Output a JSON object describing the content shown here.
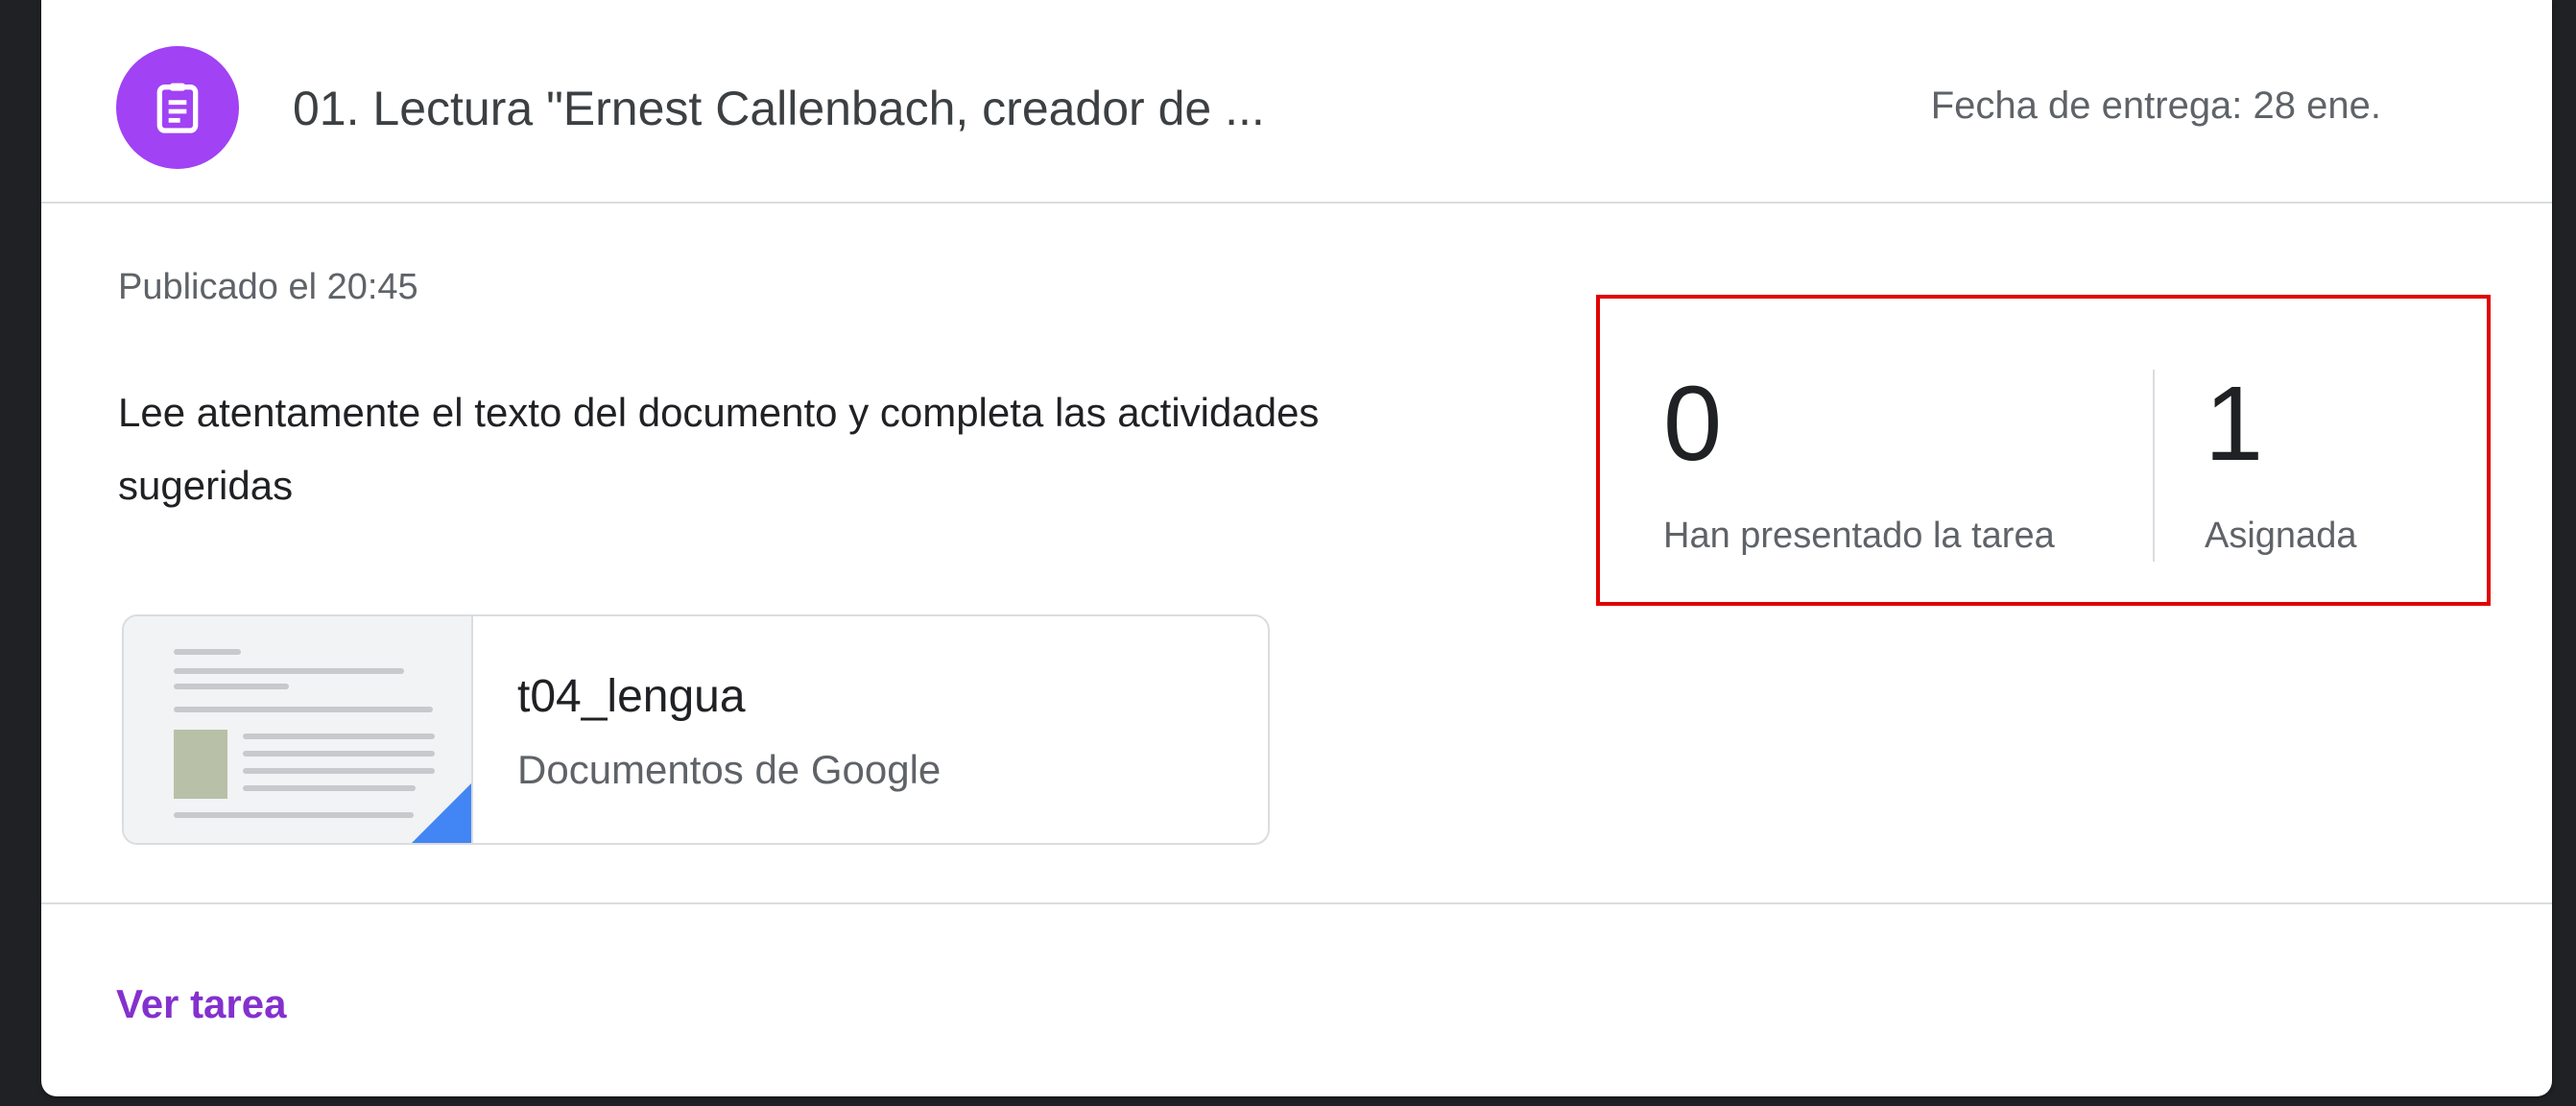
{
  "assignment": {
    "icon": "assignment-icon",
    "accent_color": "#a142f4",
    "title": "01. Lectura \"Ernest Callenbach, creador de ...",
    "due_date": "Fecha de entrega: 28 ene."
  },
  "details": {
    "posted": "Publicado el 20:45",
    "description": "Lee atentamente el texto del documento y completa las actividades sugeridas"
  },
  "attachment": {
    "title": "t04_lengua",
    "type": "Documentos de Google",
    "icon": "google-docs-icon",
    "icon_color": "#4285f4"
  },
  "stats": {
    "turned_in": {
      "count": "0",
      "label": "Han presentado la tarea"
    },
    "assigned": {
      "count": "1",
      "label": "Asignada"
    },
    "highlight_color": "#e00000"
  },
  "footer": {
    "view_link": "Ver tarea",
    "link_color": "#8430ce"
  }
}
